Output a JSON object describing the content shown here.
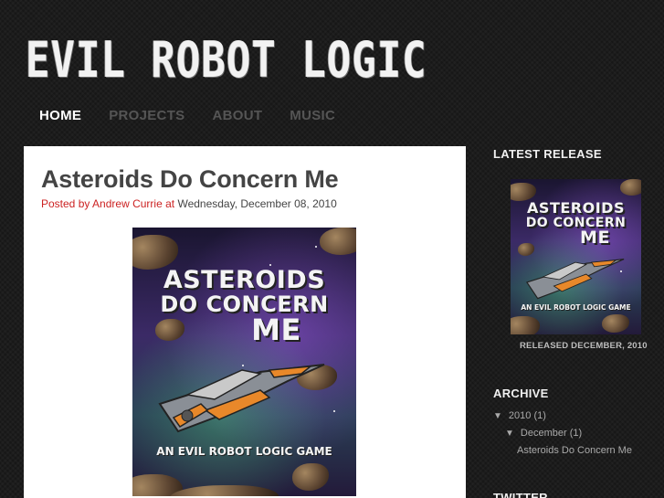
{
  "site": {
    "title": "EVIL ROBOT LOGIC"
  },
  "nav": [
    {
      "label": "HOME",
      "active": true
    },
    {
      "label": "PROJECTS",
      "active": false
    },
    {
      "label": "ABOUT",
      "active": false
    },
    {
      "label": "MUSIC",
      "active": false
    }
  ],
  "post": {
    "title": "Asteroids Do Concern Me",
    "posted_by_prefix": "Posted by",
    "author": "Andrew Currie",
    "at": "at",
    "date": "Wednesday, December 08, 2010",
    "cover": {
      "line1": "ASTEROIDS",
      "line2": "DO CONCERN",
      "line3": "ME",
      "subtitle": "AN EVIL ROBOT LOGIC GAME"
    }
  },
  "sidebar": {
    "latest_release": {
      "heading": "LATEST RELEASE",
      "caption": "RELEASED DECEMBER, 2010"
    },
    "archive": {
      "heading": "ARCHIVE",
      "year": "2010",
      "year_count": "(1)",
      "month": "December",
      "month_count": "(1)",
      "post_link": "Asteroids Do Concern Me"
    },
    "twitter": {
      "heading": "TWITTER"
    }
  },
  "colors": {
    "accent_red": "#cc2222",
    "background": "#1c1c1c",
    "nav_inactive": "#555555"
  },
  "icons": {
    "expand": "triangle-down-icon"
  }
}
